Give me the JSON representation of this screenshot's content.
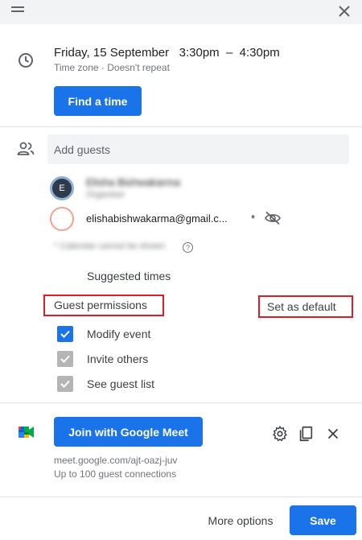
{
  "event": {
    "datetime": "Friday, 15 September   3:30pm  –  4:30pm",
    "timezone_line": "Time zone · Doesn't repeat",
    "find_time_label": "Find a time"
  },
  "guests": {
    "input_placeholder": "Add guests",
    "list": [
      {
        "initial": "E",
        "name": "Elisha Bishwakarma",
        "role": "Organiser"
      },
      {
        "email": "elishabishwakarma@gmail.c...",
        "marker": "*"
      }
    ],
    "calendar_note": "* Calendar cannot be shown",
    "suggested_times": "Suggested times"
  },
  "permissions": {
    "title": "Guest permissions",
    "set_default": "Set as default",
    "options": [
      {
        "label": "Modify event",
        "checked": true,
        "enabled": true
      },
      {
        "label": "Invite others",
        "checked": true,
        "enabled": false
      },
      {
        "label": "See guest list",
        "checked": true,
        "enabled": false
      }
    ]
  },
  "meet": {
    "join_label": "Join with Google Meet",
    "url": "meet.google.com/ajt-oazj-juv",
    "capacity": "Up to 100 guest connections"
  },
  "footer": {
    "more_options": "More options",
    "save": "Save"
  },
  "colors": {
    "accent": "#1a73e8",
    "highlight_box": "#e01c24",
    "disabled_checkbox": "#b5b5b5"
  }
}
